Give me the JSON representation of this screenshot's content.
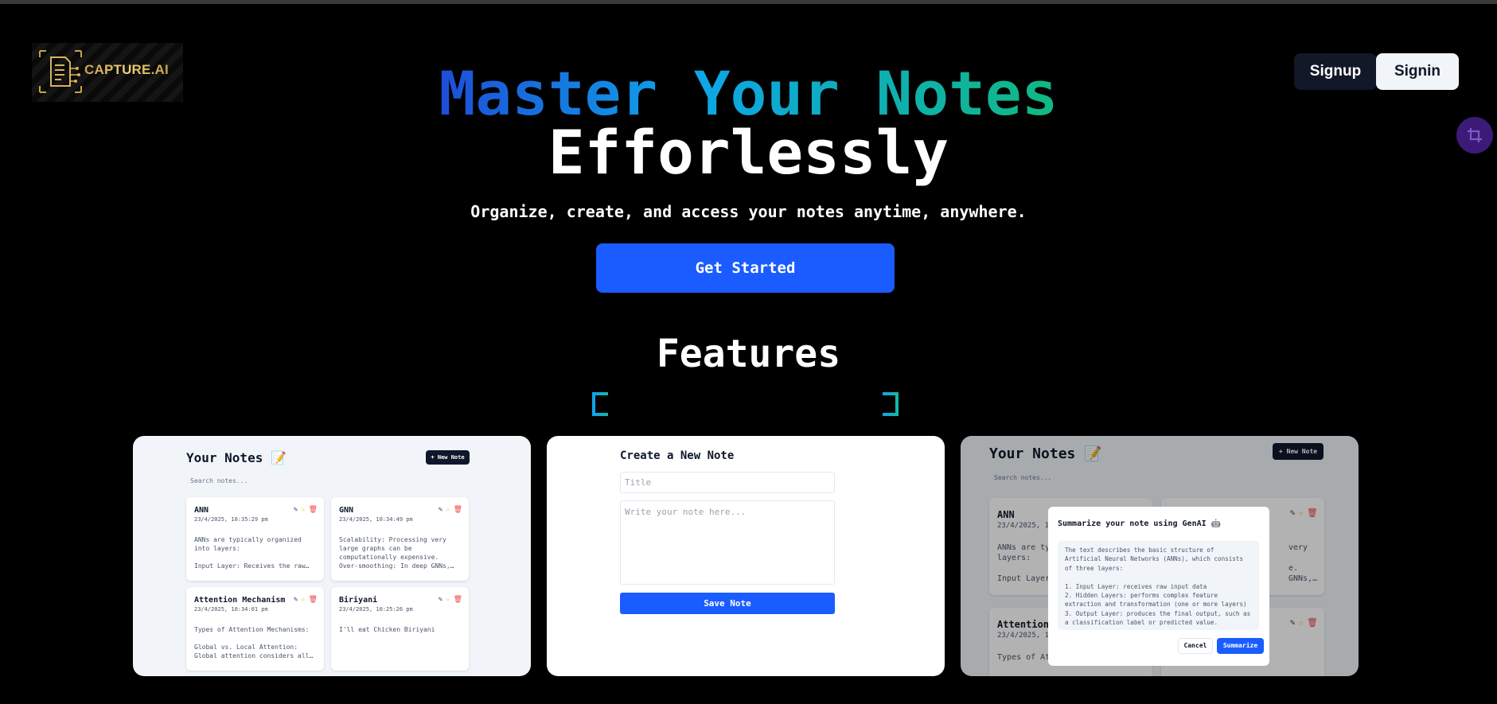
{
  "brand": {
    "name": "CAPTURE.AI"
  },
  "auth": {
    "signup": "Signup",
    "signin": "Signin"
  },
  "hero": {
    "title_gradient": "Master Your Notes",
    "title_plain": "Efforlessly",
    "subtitle": "Organize, create, and access your notes anytime, anywhere.",
    "cta": "Get Started"
  },
  "features": {
    "title": "Features"
  },
  "card1": {
    "title": "Your Notes 📝",
    "new_note": "+ New Note",
    "search_placeholder": "Search notes...",
    "notes": [
      {
        "title": "ANN",
        "date": "23/4/2025, 10:35:29 pm",
        "body": "ANNs are typically organized into layers:\n\nInput Layer: Receives the raw…"
      },
      {
        "title": "GNN",
        "date": "23/4/2025, 10:34:49 pm",
        "body": "Scalability: Processing very large graphs can be computationally expensive.\nOver-smoothing: In deep GNNs,…"
      },
      {
        "title": "Attention Mechanism",
        "date": "23/4/2025, 10:34:01 pm",
        "body": "Types of Attention Mechanisms:\n\nGlobal vs. Local Attention:\nGlobal attention considers all…"
      },
      {
        "title": "Biriyani",
        "date": "23/4/2025, 10:25:26 pm",
        "body": "I'll eat Chicken Biriyani"
      }
    ]
  },
  "card2": {
    "title": "Create a New Note",
    "title_placeholder": "Title",
    "body_placeholder": "Write your note here...",
    "save": "Save Note"
  },
  "card3": {
    "title": "Your Notes 📝",
    "new_note": "+ New Note",
    "search_placeholder": "Search notes...",
    "bg_notes": [
      {
        "title": "ANN",
        "date": "23/4/2025, 10",
        "body": "ANNs are ty\nlayers:\n\nInput Layer"
      },
      {
        "title": "Attention",
        "date": "23/4/2025, 10",
        "body": "Types of Att"
      }
    ],
    "bg_right_snippet": "very\n\ne.\nGNNs,…",
    "modal": {
      "title": "Summarize your note using GenAI 🤖",
      "body": "The text describes the basic structure of Artificial Neural Networks (ANNs), which consists of three layers:\n\n1. Input Layer: receives raw input data\n2. Hidden Layers: performs complex feature extraction and transformation (one or more layers)\n3. Output Layer: produces the final output, such as a classification label or predicted value.",
      "cancel": "Cancel",
      "summarize": "Summarize"
    }
  }
}
